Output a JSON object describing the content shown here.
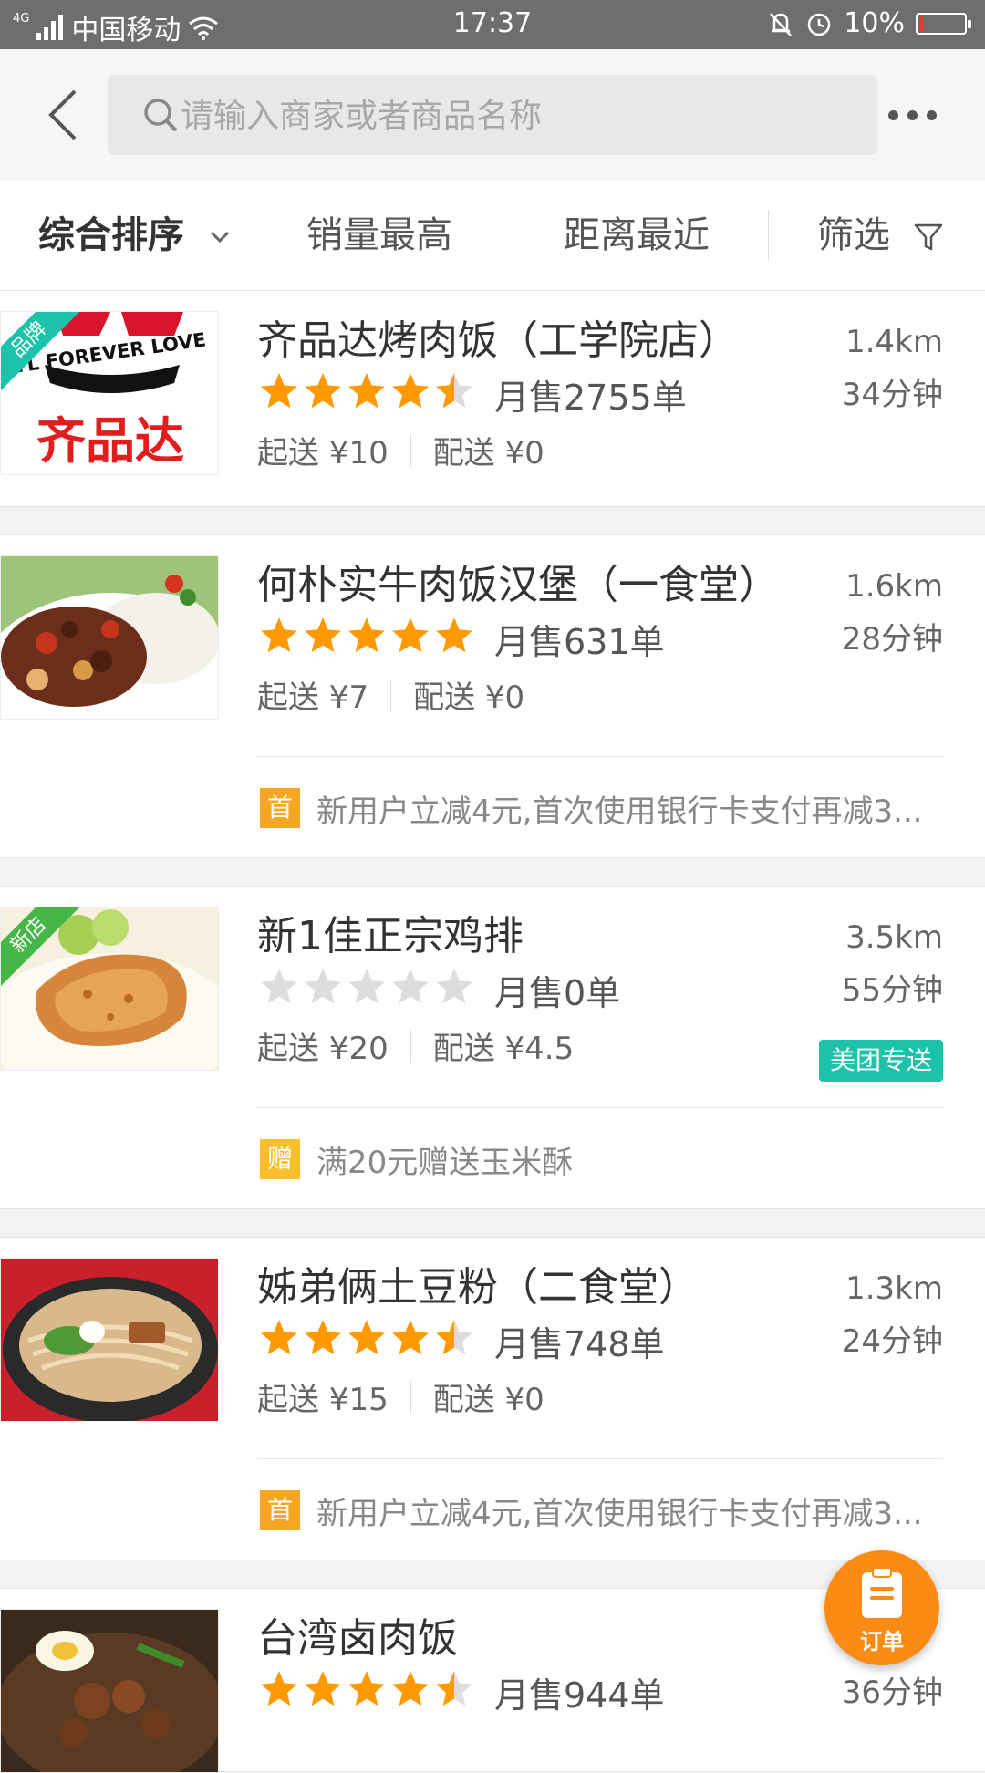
{
  "status_bar": {
    "network": "4G",
    "carrier": "中国移动",
    "time": "17:37",
    "battery": "10%",
    "battery_level": 0.1
  },
  "search": {
    "placeholder": "请输入商家或者商品名称"
  },
  "sort_bar": {
    "items": [
      "综合排序",
      "销量最高",
      "距离最近",
      "筛选"
    ]
  },
  "colors": {
    "accent": "#fa8c16",
    "star": "#ff9900",
    "star_empty": "#dddddd",
    "first_order_badge": "#f5a623",
    "gift_badge": "#f7c028",
    "meituan_delivery": "#1cc2a9"
  },
  "shops": [
    {
      "name": "齐品达烤肉饭（工学院店）",
      "rating": 4.5,
      "monthly_sales": "月售2755单",
      "distance": "1.4km",
      "delivery_time": "34分钟",
      "min_order": "起送 ¥10",
      "delivery_fee": "配送 ¥0",
      "tag": "品牌",
      "logo_text_top": "YL FOREVER LOVE",
      "logo_text_main": "齐品达"
    },
    {
      "name": "何朴实牛肉饭汉堡（一食堂）",
      "rating": 5,
      "monthly_sales": "月售631单",
      "distance": "1.6km",
      "delivery_time": "28分钟",
      "min_order": "起送 ¥7",
      "delivery_fee": "配送 ¥0",
      "promo_badge": "首",
      "promo_text": "新用户立减4元,首次使用银行卡支付再减3..."
    },
    {
      "name": "新1佳正宗鸡排",
      "rating": 0,
      "monthly_sales": "月售0单",
      "distance": "3.5km",
      "delivery_time": "55分钟",
      "min_order": "起送 ¥20",
      "delivery_fee": "配送 ¥4.5",
      "tag": "新店",
      "delivery_badge": "美团专送",
      "promo_badge": "赠",
      "promo_text": "满20元赠送玉米酥"
    },
    {
      "name": "姊弟俩土豆粉（二食堂）",
      "rating": 4.5,
      "monthly_sales": "月售748单",
      "distance": "1.3km",
      "delivery_time": "24分钟",
      "min_order": "起送 ¥15",
      "delivery_fee": "配送 ¥0",
      "promo_badge": "首",
      "promo_text": "新用户立减4元,首次使用银行卡支付再减3..."
    },
    {
      "name": "台湾卤肉饭",
      "rating": 4.5,
      "monthly_sales": "月售944单",
      "delivery_time": "36分钟"
    }
  ],
  "order_button": {
    "label": "订单"
  }
}
